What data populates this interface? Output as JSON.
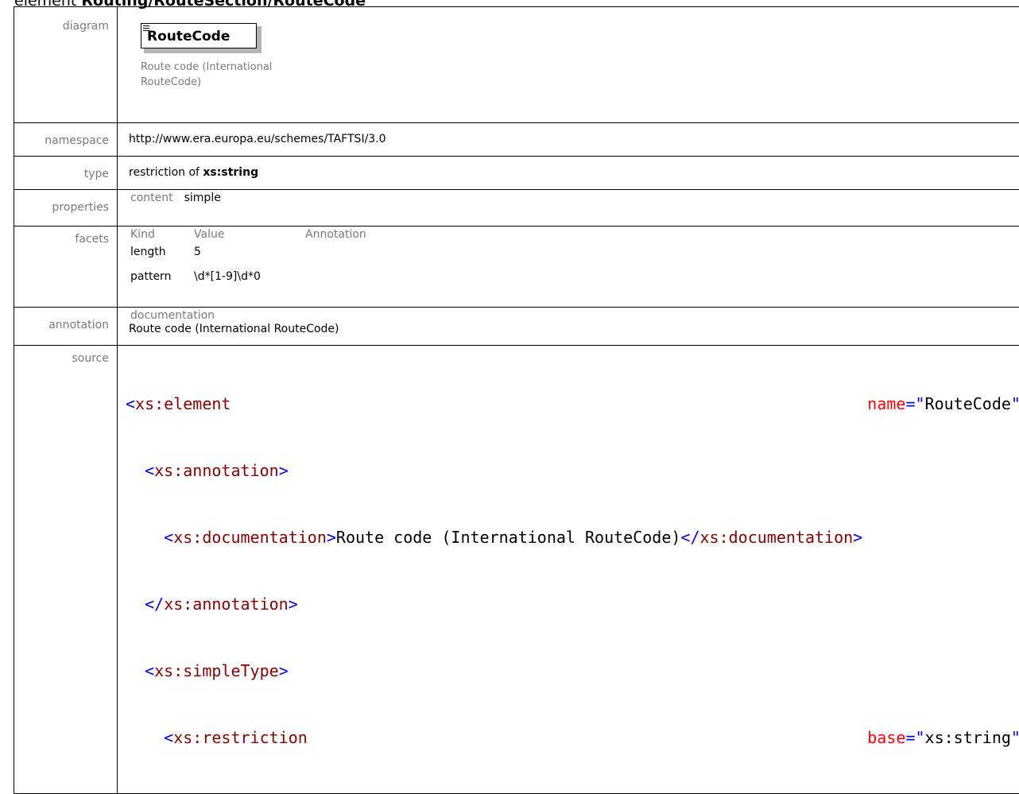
{
  "title": {
    "prefix": "element",
    "path": "Routing/RouteSection/RouteCode"
  },
  "rows": {
    "diagram": {
      "label": "diagram",
      "element_name": "RouteCode",
      "caption": "Route code (International RouteCode)"
    },
    "namespace": {
      "label": "namespace",
      "value": "http://www.era.europa.eu/schemes/TAFTSI/3.0"
    },
    "type": {
      "label": "type",
      "prefix": "restriction of",
      "base": "xs:string"
    },
    "properties": {
      "label": "properties",
      "key": "content",
      "value": "simple"
    },
    "facets": {
      "label": "facets",
      "headers": [
        "Kind",
        "Value",
        "Annotation"
      ],
      "items": [
        {
          "kind": "length",
          "value": "5",
          "annotation": ""
        },
        {
          "kind": "pattern",
          "value": "\\d*[1-9]\\d*0",
          "annotation": ""
        }
      ]
    },
    "annotation": {
      "label": "annotation",
      "head": "documentation",
      "text": "Route code (International RouteCode)"
    },
    "source": {
      "label": "source",
      "lines": [
        {
          "open": "<",
          "tag": "xs:element",
          "attr": "name",
          "eq": "=\"",
          "val": "RouteCode",
          "close": "\">"
        },
        {
          "indent": "  ",
          "open": "<",
          "tag": "xs:annotation",
          "close": ">"
        },
        {
          "indent": "    ",
          "open": "<",
          "tag": "xs:documentation",
          "mid": ">",
          "text": "Route code (International RouteCode)",
          "open2": "</",
          "tag2": "xs:documentation",
          "close": ">"
        },
        {
          "indent": "  ",
          "open": "</",
          "tag": "xs:annotation",
          "close": ">"
        },
        {
          "indent": "  ",
          "open": "<",
          "tag": "xs:simpleType",
          "close": ">"
        },
        {
          "indent": "    ",
          "open": "<",
          "tag": "xs:restriction",
          "attr": "base",
          "eq": "=\"",
          "val": "xs:string",
          "close": "\">"
        }
      ]
    }
  }
}
